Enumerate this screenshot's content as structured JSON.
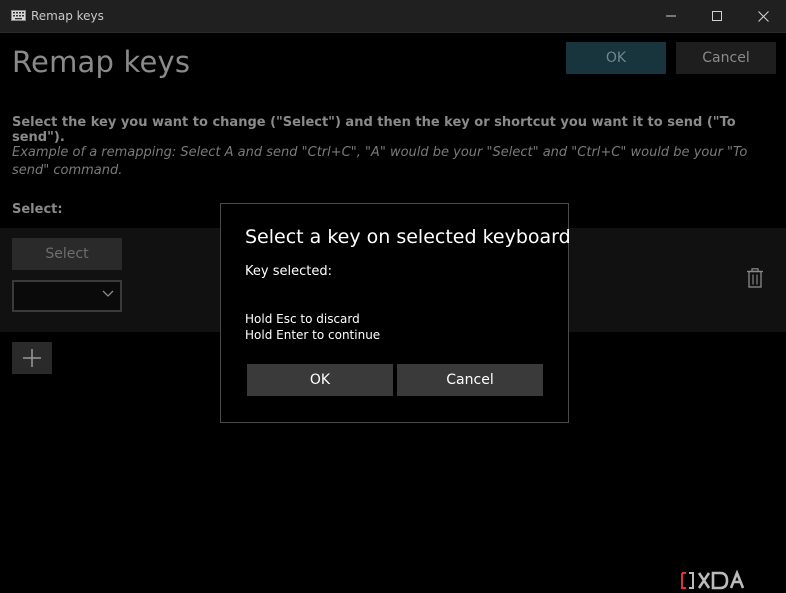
{
  "window": {
    "title": "Remap keys"
  },
  "header": {
    "title": "Remap keys",
    "ok_label": "OK",
    "cancel_label": "Cancel"
  },
  "content": {
    "instruction": "Select the key you want to change (\"Select\") and then the key or shortcut you want it to send (\"To send\").",
    "example": "Example of a remapping: Select A and send \"Ctrl+C\", \"A\" would be your \"Select\" and \"Ctrl+C\" would be your \"To send\" command.",
    "select_label": "Select:",
    "row": {
      "select_button": "Select",
      "dropdown_value": ""
    }
  },
  "dialog": {
    "title": "Select a key on selected keyboard",
    "key_selected_label": "Key selected:",
    "hint_discard": "Hold Esc to discard",
    "hint_continue": "Hold Enter to continue",
    "ok_label": "OK",
    "cancel_label": "Cancel"
  },
  "icons": {
    "app": "keyboard-icon",
    "delete": "trash-icon",
    "add": "plus-icon",
    "dropdown": "chevron-down-icon"
  },
  "colors": {
    "accent_disabled": "#18343c",
    "background": "#000000"
  }
}
